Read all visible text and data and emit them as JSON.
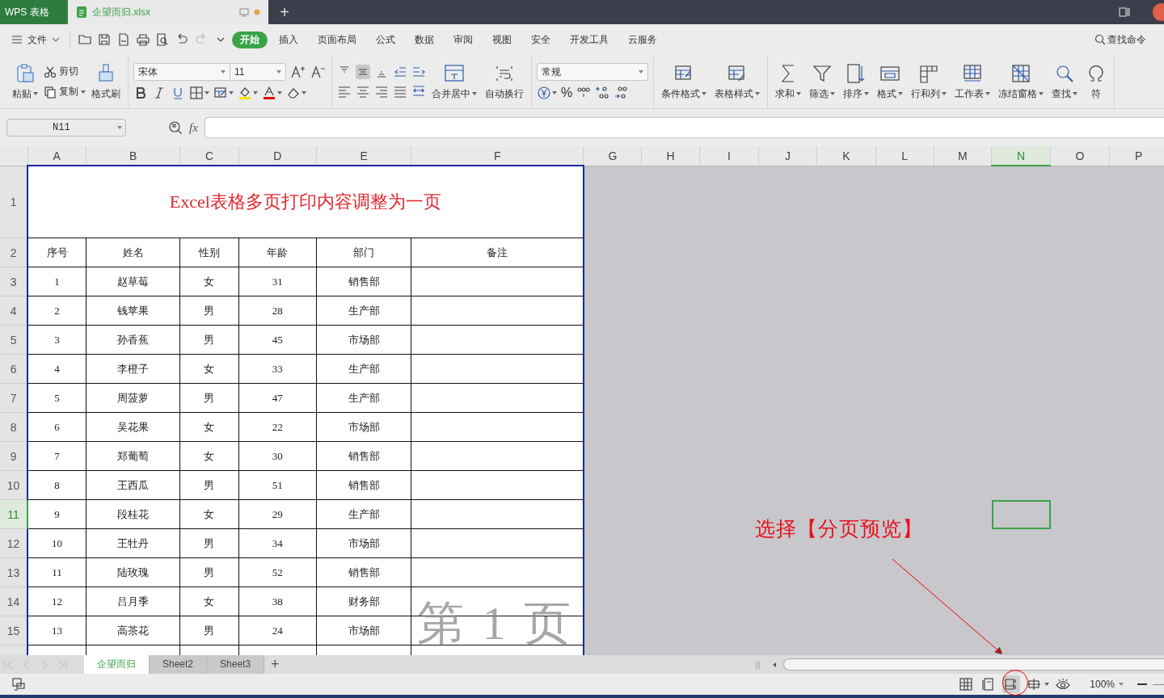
{
  "title_bar": {
    "app_tab": "WPS 表格",
    "doc_tab": {
      "name": "企望而归.xlsx",
      "unsaved": true
    },
    "new_tab": "+"
  },
  "menu": {
    "file": "文件",
    "tabs": [
      {
        "label": "开始",
        "selected": true
      },
      {
        "label": "插入",
        "selected": false
      },
      {
        "label": "页面布局",
        "selected": false
      },
      {
        "label": "公式",
        "selected": false
      },
      {
        "label": "数据",
        "selected": false
      },
      {
        "label": "审阅",
        "selected": false
      },
      {
        "label": "视图",
        "selected": false
      },
      {
        "label": "安全",
        "selected": false
      },
      {
        "label": "开发工具",
        "selected": false
      },
      {
        "label": "云服务",
        "selected": false
      }
    ],
    "search_command": "查找命令"
  },
  "ribbon": {
    "paste": "粘贴",
    "cut": "剪切",
    "copy": "复制",
    "format_painter": "格式刷",
    "font": "宋体",
    "font_size": "11",
    "merge": "合并居中",
    "wrap": "自动换行",
    "number_format": "常规",
    "number_buttons": [
      "%"
    ],
    "tools": [
      "条件格式",
      "表格样式",
      "求和",
      "筛选",
      "排序",
      "格式",
      "行和列",
      "工作表",
      "冻结窗格",
      "查找",
      "符"
    ]
  },
  "formula_bar": {
    "name_box": "N11",
    "fx": "fx"
  },
  "columns": [
    {
      "label": "A",
      "selected": false
    },
    {
      "label": "B",
      "selected": false
    },
    {
      "label": "C",
      "selected": false
    },
    {
      "label": "D",
      "selected": false
    },
    {
      "label": "E",
      "selected": false
    },
    {
      "label": "F",
      "selected": false
    },
    {
      "label": "G",
      "selected": false
    },
    {
      "label": "H",
      "selected": false
    },
    {
      "label": "I",
      "selected": false
    },
    {
      "label": "J",
      "selected": false
    },
    {
      "label": "K",
      "selected": false
    },
    {
      "label": "L",
      "selected": false
    },
    {
      "label": "M",
      "selected": false
    },
    {
      "label": "N",
      "selected": true
    },
    {
      "label": "O",
      "selected": false
    },
    {
      "label": "P",
      "selected": false
    }
  ],
  "row_numbers": [
    {
      "label": "1",
      "selected": false
    },
    {
      "label": "2",
      "selected": false
    },
    {
      "label": "3",
      "selected": false
    },
    {
      "label": "4",
      "selected": false
    },
    {
      "label": "5",
      "selected": false
    },
    {
      "label": "6",
      "selected": false
    },
    {
      "label": "7",
      "selected": false
    },
    {
      "label": "8",
      "selected": false
    },
    {
      "label": "9",
      "selected": false
    },
    {
      "label": "10",
      "selected": false
    },
    {
      "label": "11",
      "selected": true
    },
    {
      "label": "12",
      "selected": false
    },
    {
      "label": "13",
      "selected": false
    },
    {
      "label": "14",
      "selected": false
    },
    {
      "label": "15",
      "selected": false
    }
  ],
  "sheet_title": "Excel表格多页打印内容调整为一页",
  "table_header": [
    "序号",
    "姓名",
    "性别",
    "年龄",
    "部门",
    "备注"
  ],
  "table_rows": [
    [
      "1",
      "赵草莓",
      "女",
      "31",
      "销售部"
    ],
    [
      "2",
      "钱苹果",
      "男",
      "28",
      "生产部"
    ],
    [
      "3",
      "孙香蕉",
      "男",
      "45",
      "市场部"
    ],
    [
      "4",
      "李橙子",
      "女",
      "33",
      "生产部"
    ],
    [
      "5",
      "周菠萝",
      "男",
      "47",
      "生产部"
    ],
    [
      "6",
      "吴花果",
      "女",
      "22",
      "市场部"
    ],
    [
      "7",
      "郑葡萄",
      "女",
      "30",
      "销售部"
    ],
    [
      "8",
      "王西瓜",
      "男",
      "51",
      "销售部"
    ],
    [
      "9",
      "段桂花",
      "女",
      "29",
      "生产部"
    ],
    [
      "10",
      "王牡丹",
      "男",
      "34",
      "市场部"
    ],
    [
      "11",
      "陆玫瑰",
      "男",
      "52",
      "销售部"
    ],
    [
      "12",
      "吕月季",
      "女",
      "38",
      "财务部"
    ],
    [
      "13",
      "高茶花",
      "男",
      "24",
      "市场部"
    ]
  ],
  "page_label": "第 1 页",
  "annotation": "选择【分页预览】",
  "sheet_tabs": [
    {
      "label": "企望而归",
      "selected": true
    },
    {
      "label": "Sheet2",
      "selected": false
    },
    {
      "label": "Sheet3",
      "selected": false
    }
  ],
  "add_sheet": "+",
  "status_bar": {
    "views": [
      {
        "selected": false
      },
      {
        "selected": false
      },
      {
        "selected": true
      },
      {
        "selected": false
      },
      {
        "selected": false
      }
    ],
    "zoom": "100%"
  }
}
